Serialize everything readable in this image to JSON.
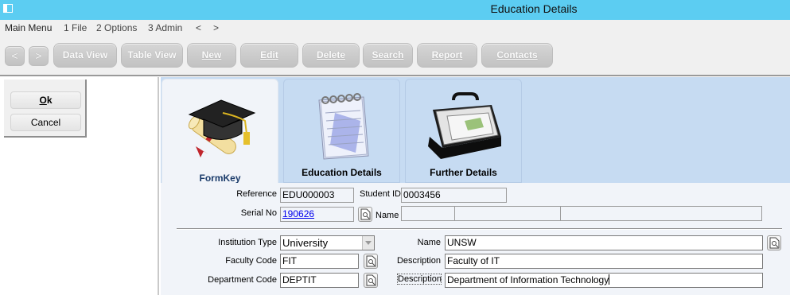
{
  "window": {
    "title": "Education Details"
  },
  "menu": {
    "main_menu": "Main Menu",
    "file": "1 File",
    "options": "2 Options",
    "admin": "3 Admin",
    "back": "<",
    "forward": ">"
  },
  "toolbar": {
    "prev": "<",
    "next": ">",
    "data_view": "Data View",
    "table_view": "Table View",
    "new": "New",
    "edit": "Edit",
    "delete": "Delete",
    "search": "Search",
    "report": "Report",
    "contacts": "Contacts"
  },
  "dialog": {
    "ok_o": "O",
    "ok_rest": "k",
    "cancel": "Cancel"
  },
  "tabs": [
    {
      "label": "FormKey",
      "icon": "graduation-cap-diploma-icon",
      "active": true
    },
    {
      "label": "Education Details",
      "icon": "notepad-icon",
      "active": false
    },
    {
      "label": "Further Details",
      "icon": "briefcase-icon",
      "active": false
    }
  ],
  "form": {
    "reference_label": "Reference",
    "reference_value": "EDU000003",
    "student_id_label": "Student ID",
    "student_id_value": "0003456",
    "serial_no_label": "Serial No",
    "serial_no_value": "190626",
    "name_label": "Name",
    "name_parts": [
      "",
      "",
      ""
    ],
    "institution_type_label": "Institution Type",
    "institution_type_value": "University",
    "institution_name_label": "Name",
    "institution_name_value": "UNSW",
    "faculty_code_label": "Faculty Code",
    "faculty_code_value": "FIT",
    "faculty_description_label": "Description",
    "faculty_description_value": "Faculty of IT",
    "department_code_label": "Department Code",
    "department_code_value": "DEPTIT",
    "department_description_label": "Description",
    "department_description_value": "Department of Information Technology"
  },
  "colors": {
    "titlebar": "#5ccdf2",
    "tab_area": "#c6dbf2",
    "form_bg": "#f1f4f9",
    "link": "#0000ee"
  }
}
